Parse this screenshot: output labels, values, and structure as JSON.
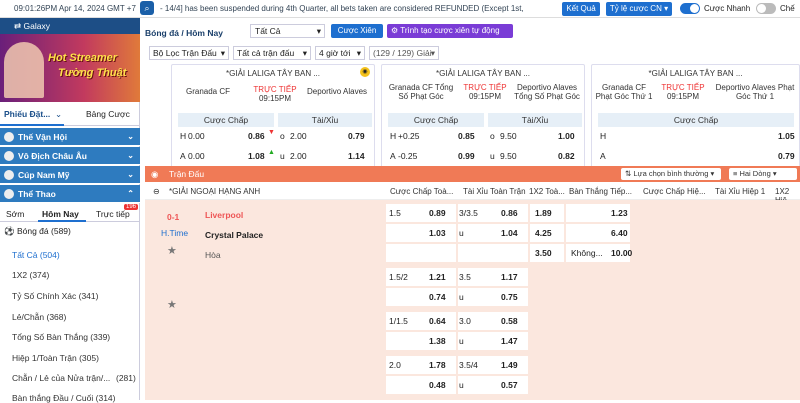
{
  "topbar": {
    "time": "09:01:26PM Apr 14, 2024 GMT +7",
    "marquee": "- 14/4] has been suspended during 4th Quarter, all bets taken are considered REFUNDED (Except 1st,",
    "ket_qua": "Kết Quả",
    "odds_type": "Tỷ lệ cược CN",
    "quick_bet": "Cược Nhanh",
    "dark": "Chế"
  },
  "sidebar": {
    "galaxy": "Galaxy",
    "banner_line1": "Hot Streamer",
    "banner_line2": "Tường Thuật",
    "tab_slip": "Phiếu Đặt...",
    "tab_bets": "Bảng Cược",
    "sections": [
      "Thế Vận Hội",
      "Vô Địch Châu Âu",
      "Cúp Nam Mỹ",
      "Thể Thao"
    ],
    "subtabs": [
      "Sớm",
      "Hôm Nay",
      "Trực tiếp"
    ],
    "live_badge": "196",
    "sport": "Bóng đá",
    "sport_count": "(589)",
    "menu": [
      {
        "label": "Tất Cả (504)",
        "count": ""
      },
      {
        "label": "1X2 (374)",
        "count": ""
      },
      {
        "label": "Tỷ Số Chính Xác (341)",
        "count": ""
      },
      {
        "label": "Lẻ/Chẵn (368)",
        "count": ""
      },
      {
        "label": "Tổng Số Bàn Thắng (339)",
        "count": ""
      },
      {
        "label": "Hiệp 1/Toàn Trận (305)",
        "count": ""
      },
      {
        "label": "Chẵn / Lẻ của Nửa trận/...",
        "count": "(281)"
      },
      {
        "label": "Bàn thắng Đầu / Cuối (314)",
        "count": ""
      }
    ]
  },
  "filters": {
    "breadcrumb": "Bóng đá / Hôm Nay",
    "select_all": "Tất Cả",
    "cuoc_xien": "Cược Xiên",
    "builder": "Trình tạo cược xiên tự động",
    "loc_tran": "Bộ Lọc Trận Đấu",
    "all_leagues": "Tất cả trận đấu",
    "hours": "4 giờ tới",
    "count": "(129 / 129) Giải"
  },
  "cards": [
    {
      "league": "*GIẢI LALIGA TÂY BAN ...",
      "home": "Granada CF",
      "away": "Deportivo Alaves",
      "status": "TRỰC TIẾP",
      "time": "09:15PM",
      "h1": "Cược Chấp",
      "h2": "Tài/Xỉu",
      "r1": [
        "H",
        "0.00",
        "0.86",
        "o",
        "2.00",
        "0.79"
      ],
      "r2": [
        "A",
        "0.00",
        "1.08",
        "u",
        "2.00",
        "1.14"
      ]
    },
    {
      "league": "*GIẢI LALIGA TÂY BAN ...",
      "home": "Granada CF Tổng Số Phạt Góc",
      "away": "Deportivo Alaves Tổng Số Phạt Góc",
      "status": "TRỰC TIẾP",
      "time": "09:15PM",
      "h1": "Cược Chấp",
      "h2": "Tài/Xỉu",
      "r1": [
        "H",
        "+0.25",
        "0.85",
        "o",
        "9.50",
        "1.00"
      ],
      "r2": [
        "A",
        "-0.25",
        "0.99",
        "u",
        "9.50",
        "0.82"
      ]
    },
    {
      "league": "*GIẢI LALIGA TÂY BAN ...",
      "home": "Granada CF Phạt Góc Thứ 1",
      "away": "Deportivo Alaves Phạt Góc Thứ 1",
      "status": "TRỰC TIẾP",
      "time": "09:15PM",
      "h1": "Cược Chấp",
      "h2": "",
      "r1": [
        "H",
        "",
        "1.05",
        "",
        "",
        ""
      ],
      "r2": [
        "A",
        "",
        "0.79",
        "",
        "",
        ""
      ]
    }
  ],
  "matches": {
    "title": "Trận Đấu",
    "sort": "Lựa chọn bình thường",
    "lines": "Hai Dòng",
    "columns": [
      "Cược Chấp Toà...",
      "Tài Xỉu Toàn Trận",
      "1X2 Toà...",
      "Bàn Thắng Tiếp...",
      "Cược Chấp Hiệ...",
      "Tài Xỉu Hiệp 1",
      "1X2 Hiệ"
    ],
    "league": "*GIẢI NGOẠI HẠNG ANH",
    "score": "0-1",
    "period": "H.Time",
    "home": "Liverpool",
    "away": "Crystal Palace",
    "draw": "Hòa",
    "rows": [
      [
        "1.5",
        "0.89",
        "3/3.5",
        "0.86",
        "1.89",
        "",
        "1.23"
      ],
      [
        "",
        "1.03",
        "u",
        "1.04",
        "4.25",
        "",
        "6.40"
      ],
      [
        "",
        "",
        "",
        "",
        "3.50",
        "Không...",
        "10.00"
      ],
      [
        "1.5/2",
        "1.21",
        "3.5",
        "1.17",
        "",
        "",
        ""
      ],
      [
        "",
        "0.74",
        "u",
        "0.75",
        "",
        "",
        ""
      ],
      [
        "1/1.5",
        "0.64",
        "3.0",
        "0.58",
        "",
        "",
        ""
      ],
      [
        "",
        "1.38",
        "u",
        "1.47",
        "",
        "",
        ""
      ],
      [
        "2.0",
        "1.78",
        "3.5/4",
        "1.49",
        "",
        "",
        ""
      ],
      [
        "",
        "0.48",
        "u",
        "0.57",
        "",
        "",
        ""
      ]
    ]
  }
}
